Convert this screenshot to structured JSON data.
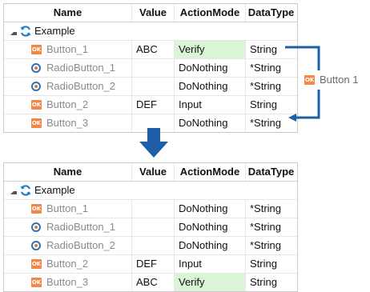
{
  "columns": [
    "Name",
    "Value",
    "ActionMode",
    "DataType"
  ],
  "root_label": "Example",
  "top_grid": {
    "rows": [
      {
        "name": "Button_1",
        "icon": "ok-button-icon",
        "value": "ABC",
        "action": "Verify",
        "type": "String"
      },
      {
        "name": "RadioButton_1",
        "icon": "radio-button-icon",
        "value": "",
        "action": "DoNothing",
        "type": "*String"
      },
      {
        "name": "RadioButton_2",
        "icon": "radio-button-icon",
        "value": "",
        "action": "DoNothing",
        "type": "*String"
      },
      {
        "name": "Button_2",
        "icon": "ok-button-icon",
        "value": "DEF",
        "action": "Input",
        "type": "String"
      },
      {
        "name": "Button_3",
        "icon": "ok-button-icon",
        "value": "",
        "action": "DoNothing",
        "type": "*String"
      }
    ]
  },
  "bottom_grid": {
    "rows": [
      {
        "name": "Button_1",
        "icon": "ok-button-icon",
        "value": "",
        "action": "DoNothing",
        "type": "*String"
      },
      {
        "name": "RadioButton_1",
        "icon": "radio-button-icon",
        "value": "",
        "action": "DoNothing",
        "type": "*String"
      },
      {
        "name": "RadioButton_2",
        "icon": "radio-button-icon",
        "value": "",
        "action": "DoNothing",
        "type": "*String"
      },
      {
        "name": "Button_2",
        "icon": "ok-button-icon",
        "value": "DEF",
        "action": "Input",
        "type": "String"
      },
      {
        "name": "Button_3",
        "icon": "ok-button-icon",
        "value": "ABC",
        "action": "Verify",
        "type": "String"
      }
    ]
  },
  "callout": {
    "icon_text": "OK",
    "label": "Button 1"
  },
  "icon_ok_text": "OK",
  "colors": {
    "verify_bg": "#d9f5d5",
    "accent_blue": "#1f5fa8",
    "ok_orange": "#f2874a"
  }
}
